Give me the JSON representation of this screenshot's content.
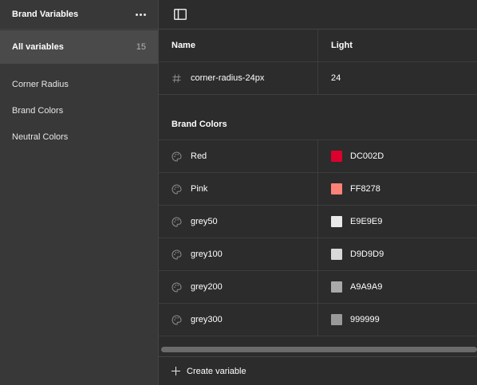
{
  "sidebar": {
    "title": "Brand Variables",
    "all_label": "All variables",
    "all_count": "15",
    "groups": [
      "Corner Radius",
      "Brand Colors",
      "Neutral Colors"
    ]
  },
  "table": {
    "col_name": "Name",
    "col_mode": "Light",
    "radius_row": {
      "name": "corner-radius-24px",
      "value": "24",
      "icon": "hash-icon"
    },
    "group_title": "Brand Colors",
    "color_rows": [
      {
        "name": "Red",
        "value": "DC002D",
        "hex": "#DC002D"
      },
      {
        "name": "Pink",
        "value": "FF8278",
        "hex": "#FF8278"
      },
      {
        "name": "grey50",
        "value": "E9E9E9",
        "hex": "#E9E9E9"
      },
      {
        "name": "grey100",
        "value": "D9D9D9",
        "hex": "#D9D9D9"
      },
      {
        "name": "grey200",
        "value": "A9A9A9",
        "hex": "#A9A9A9"
      },
      {
        "name": "grey300",
        "value": "999999",
        "hex": "#999999"
      }
    ]
  },
  "footer": {
    "create_label": "Create variable"
  },
  "icons": {
    "header_more": "more-icon",
    "toolbar": "sidebar-toggle-icon",
    "color": "palette-icon",
    "create": "plus-icon"
  }
}
